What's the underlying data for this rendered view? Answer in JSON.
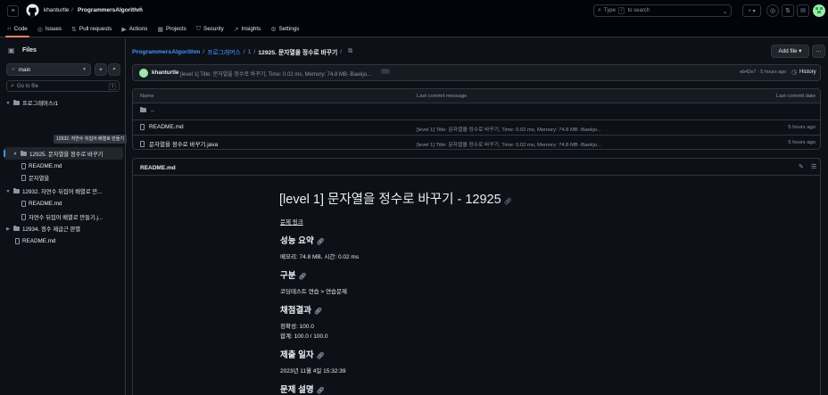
{
  "header": {
    "owner": "khanturtle",
    "separator": "/",
    "repo": "ProgrammersAlgorithm",
    "search_prompt": "Type",
    "search_key": "/",
    "search_suffix": "to search",
    "plus_label": "+ ▾"
  },
  "nav": {
    "tabs": [
      {
        "label": "Code",
        "icon": "code-icon"
      },
      {
        "label": "Issues",
        "icon": "issue-icon"
      },
      {
        "label": "Pull requests",
        "icon": "pull-request-icon"
      },
      {
        "label": "Actions",
        "icon": "actions-icon"
      },
      {
        "label": "Projects",
        "icon": "projects-icon"
      },
      {
        "label": "Security",
        "icon": "shield-icon"
      },
      {
        "label": "Insights",
        "icon": "graph-icon"
      },
      {
        "label": "Settings",
        "icon": "gear-icon"
      }
    ]
  },
  "sidebar": {
    "title": "Files",
    "branch": "main",
    "goto_placeholder": "Go to file",
    "goto_key": "t",
    "tree": [
      {
        "label": "프로그래머스/1"
      },
      {
        "label": "12925. 문자열을 정수로 바꾸기"
      },
      {
        "label": "README.md"
      },
      {
        "label": "문자열을"
      },
      {
        "label": "12932. 자연수 뒤집어 배열로 만..."
      },
      {
        "label": "README.md"
      },
      {
        "label": "자연수 뒤집어 배열로 만들기.j..."
      },
      {
        "label": "12934. 정수 제곱근 판별"
      },
      {
        "label": "README.md"
      }
    ],
    "tooltip": "12932. 자연수 뒤집어 배열로 만들기"
  },
  "breadcrumb": {
    "repo": "ProgrammersAlgorithm",
    "sep": "/",
    "dir1": "프로그래머스",
    "dir2": "1",
    "current": "12925. 문자열을 정수로 바꾸기",
    "trail": "/"
  },
  "add_file_label": "Add file ▾",
  "more_label": "···",
  "commit": {
    "author": "khanturtle",
    "message": "[level 1] Title: 문자열을 정수로 바꾸기, Time: 0.02 ms, Memory: 74.8 MB -Baekjo...",
    "hash_time": "eb42e7 · 5 hours ago",
    "history_label": "History"
  },
  "table": {
    "headers": {
      "name": "Name",
      "message": "Last commit message",
      "date": "Last commit date"
    },
    "parent": "..",
    "rows": [
      {
        "name": "README.md",
        "message": "[level 1] Title: 문자열을 정수로 바꾸기, Time: 0.02 ms, Memory: 74.8 MB -Baekjo...",
        "date": "5 hours ago"
      },
      {
        "name": "문자열을 정수로 바꾸기.java",
        "message": "[level 1] Title: 문자열을 정수로 바꾸기, Time: 0.02 ms, Memory: 74.8 MB -Baekjo...",
        "date": "5 hours ago"
      }
    ]
  },
  "readme": {
    "file_label": "README.md",
    "title": "[level 1] 문자열을 정수로 바꾸기 - 12925",
    "problem_link": "문제 링크",
    "sections": [
      {
        "heading": "성능 요약",
        "lines": [
          "메모리: 74.8 MB, 시간: 0.02 ms"
        ]
      },
      {
        "heading": "구분",
        "lines": [
          "코딩테스트 연습 > 연습문제"
        ]
      },
      {
        "heading": "채점결과",
        "lines": [
          "정확성: 100.0",
          "합계: 100.0 / 100.0"
        ]
      },
      {
        "heading": "제출 일자",
        "lines": [
          "2023년 11월 4일 15:32:39"
        ]
      },
      {
        "heading": "문제 설명",
        "lines": []
      }
    ]
  },
  "colors": {
    "accent": "#4493f8",
    "tab_underline": "#f78166",
    "bg": "#0d1117"
  }
}
